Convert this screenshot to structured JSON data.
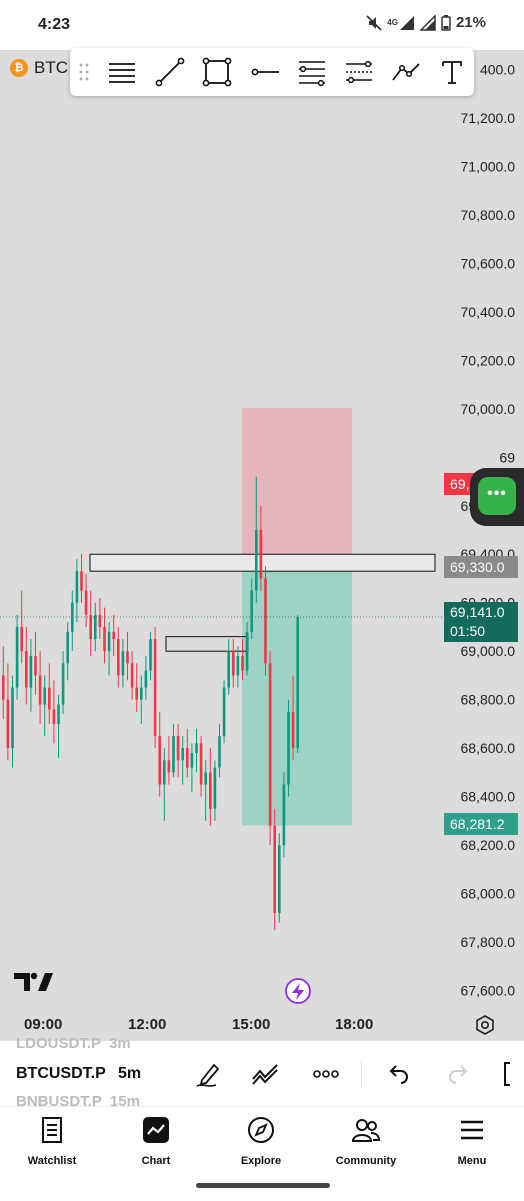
{
  "status_bar": {
    "time": "4:23",
    "network": "4G",
    "battery": "21%"
  },
  "symbol_overlay": {
    "text": "BTC",
    "coin_icon": "bitcoin-icon"
  },
  "drawing_toolbar": {
    "tools": [
      "horizontal-lines-icon",
      "trend-line-icon",
      "rectangle-icon",
      "horizontal-ray-icon",
      "fib-retracement-icon",
      "parallel-channel-icon",
      "path-icon",
      "text-icon"
    ]
  },
  "price_axis": {
    "labels": [
      "400.0",
      "71,200.0",
      "71,000.0",
      "70,800.0",
      "70,600.0",
      "70,400.0",
      "70,200.0",
      "70,000.0",
      "69",
      "69,600.0",
      "69,400.0",
      "69,200.0",
      "69,000.0",
      "68,800.0",
      "68,600.0",
      "68,400.0",
      "68,200.0",
      "68,000.0",
      "67,800.0",
      "67,600.0"
    ],
    "tags": {
      "stop": {
        "value": "69,673.3",
        "color": "#f23645"
      },
      "entry": {
        "value": "69,330.0",
        "color": "#8a8a8a"
      },
      "current": {
        "value": "69,141.0",
        "countdown": "01:50",
        "color": "#136b5c"
      },
      "target": {
        "value": "68,281.2",
        "color": "#2f9e8a"
      }
    }
  },
  "time_axis": {
    "labels": [
      "09:00",
      "12:00",
      "15:00",
      "18:00"
    ]
  },
  "fab": {
    "label": "•••",
    "color": "#35b34a"
  },
  "symbol_bar": {
    "ghost_above": "LDOUSDT.P  3m",
    "symbol": "BTCUSDT.P",
    "interval": "5m",
    "ghost_below": "BNBUSDT.P  15m"
  },
  "bottom_nav": {
    "items": [
      {
        "label": "Watchlist",
        "icon": "watchlist-icon"
      },
      {
        "label": "Chart",
        "icon": "chart-icon"
      },
      {
        "label": "Explore",
        "icon": "compass-icon"
      },
      {
        "label": "Community",
        "icon": "community-icon"
      },
      {
        "label": "Menu",
        "icon": "hamburger-icon"
      }
    ]
  },
  "colors": {
    "up": "#0a9981",
    "down": "#f23645",
    "chart_bg": "#dcdcdc",
    "stop_zone": "#e8a9b1",
    "target_zone": "#8fcfbf"
  },
  "chart_data": {
    "type": "candlestick",
    "timeframe": "5m",
    "x_ticks": [
      "09:00",
      "12:00",
      "15:00",
      "18:00"
    ],
    "ylim": [
      67520,
      71480
    ],
    "position": {
      "type": "short",
      "entry": 69330.0,
      "stop": 69673.3,
      "target": 68281.2,
      "last_price": 69141.0
    },
    "candles": [
      {
        "o": 68900,
        "h": 69020,
        "l": 68720,
        "c": 68800
      },
      {
        "o": 68800,
        "h": 68950,
        "l": 68550,
        "c": 68600
      },
      {
        "o": 68600,
        "h": 68900,
        "l": 68520,
        "c": 68850
      },
      {
        "o": 68850,
        "h": 69150,
        "l": 68800,
        "c": 69100
      },
      {
        "o": 69100,
        "h": 69250,
        "l": 68950,
        "c": 69000
      },
      {
        "o": 69000,
        "h": 69100,
        "l": 68780,
        "c": 68850
      },
      {
        "o": 68850,
        "h": 69050,
        "l": 68750,
        "c": 68980
      },
      {
        "o": 68980,
        "h": 69080,
        "l": 68820,
        "c": 68900
      },
      {
        "o": 68900,
        "h": 69000,
        "l": 68700,
        "c": 68780
      },
      {
        "o": 68780,
        "h": 68900,
        "l": 68650,
        "c": 68850
      },
      {
        "o": 68850,
        "h": 68950,
        "l": 68700,
        "c": 68760
      },
      {
        "o": 68760,
        "h": 68880,
        "l": 68620,
        "c": 68700
      },
      {
        "o": 68700,
        "h": 68820,
        "l": 68560,
        "c": 68780
      },
      {
        "o": 68780,
        "h": 69000,
        "l": 68740,
        "c": 68950
      },
      {
        "o": 68950,
        "h": 69120,
        "l": 68880,
        "c": 69080
      },
      {
        "o": 69080,
        "h": 69250,
        "l": 69000,
        "c": 69200
      },
      {
        "o": 69200,
        "h": 69380,
        "l": 69120,
        "c": 69330
      },
      {
        "o": 69330,
        "h": 69400,
        "l": 69200,
        "c": 69250
      },
      {
        "o": 69250,
        "h": 69320,
        "l": 69100,
        "c": 69150
      },
      {
        "o": 69150,
        "h": 69250,
        "l": 68980,
        "c": 69050
      },
      {
        "o": 69050,
        "h": 69200,
        "l": 69000,
        "c": 69150
      },
      {
        "o": 69150,
        "h": 69220,
        "l": 69050,
        "c": 69100
      },
      {
        "o": 69100,
        "h": 69180,
        "l": 68950,
        "c": 69000
      },
      {
        "o": 69000,
        "h": 69120,
        "l": 68900,
        "c": 69080
      },
      {
        "o": 69080,
        "h": 69150,
        "l": 68980,
        "c": 69050
      },
      {
        "o": 69050,
        "h": 69100,
        "l": 68850,
        "c": 68900
      },
      {
        "o": 68900,
        "h": 69050,
        "l": 68850,
        "c": 69000
      },
      {
        "o": 69000,
        "h": 69080,
        "l": 68880,
        "c": 68950
      },
      {
        "o": 68950,
        "h": 69000,
        "l": 68800,
        "c": 68850
      },
      {
        "o": 68850,
        "h": 68950,
        "l": 68750,
        "c": 68800
      },
      {
        "o": 68800,
        "h": 68900,
        "l": 68700,
        "c": 68850
      },
      {
        "o": 68850,
        "h": 68980,
        "l": 68800,
        "c": 68920
      },
      {
        "o": 68920,
        "h": 69080,
        "l": 68880,
        "c": 69050
      },
      {
        "o": 69050,
        "h": 69100,
        "l": 68600,
        "c": 68650
      },
      {
        "o": 68650,
        "h": 68750,
        "l": 68400,
        "c": 68450
      },
      {
        "o": 68450,
        "h": 68600,
        "l": 68300,
        "c": 68550
      },
      {
        "o": 68550,
        "h": 68650,
        "l": 68450,
        "c": 68500
      },
      {
        "o": 68500,
        "h": 68700,
        "l": 68480,
        "c": 68650
      },
      {
        "o": 68650,
        "h": 68700,
        "l": 68480,
        "c": 68550
      },
      {
        "o": 68550,
        "h": 68650,
        "l": 68450,
        "c": 68600
      },
      {
        "o": 68600,
        "h": 68680,
        "l": 68480,
        "c": 68520
      },
      {
        "o": 68520,
        "h": 68620,
        "l": 68420,
        "c": 68580
      },
      {
        "o": 68580,
        "h": 68680,
        "l": 68500,
        "c": 68620
      },
      {
        "o": 68620,
        "h": 68650,
        "l": 68400,
        "c": 68450
      },
      {
        "o": 68450,
        "h": 68550,
        "l": 68300,
        "c": 68500
      },
      {
        "o": 68500,
        "h": 68600,
        "l": 68280,
        "c": 68350
      },
      {
        "o": 68350,
        "h": 68550,
        "l": 68300,
        "c": 68520
      },
      {
        "o": 68520,
        "h": 68700,
        "l": 68480,
        "c": 68650
      },
      {
        "o": 68650,
        "h": 68880,
        "l": 68620,
        "c": 68850
      },
      {
        "o": 68850,
        "h": 69050,
        "l": 68820,
        "c": 69000
      },
      {
        "o": 69000,
        "h": 69050,
        "l": 68850,
        "c": 68900
      },
      {
        "o": 68900,
        "h": 69020,
        "l": 68850,
        "c": 68980
      },
      {
        "o": 68980,
        "h": 69050,
        "l": 68880,
        "c": 68920
      },
      {
        "o": 68920,
        "h": 69120,
        "l": 68900,
        "c": 69080
      },
      {
        "o": 69080,
        "h": 69300,
        "l": 69050,
        "c": 69250
      },
      {
        "o": 69250,
        "h": 69720,
        "l": 69200,
        "c": 69500
      },
      {
        "o": 69500,
        "h": 69600,
        "l": 69250,
        "c": 69300
      },
      {
        "o": 69300,
        "h": 69350,
        "l": 68900,
        "c": 68950
      },
      {
        "o": 68950,
        "h": 69000,
        "l": 68200,
        "c": 68280
      },
      {
        "o": 68280,
        "h": 68350,
        "l": 67850,
        "c": 67920
      },
      {
        "o": 67920,
        "h": 68250,
        "l": 67880,
        "c": 68200
      },
      {
        "o": 68200,
        "h": 68500,
        "l": 68150,
        "c": 68450
      },
      {
        "o": 68450,
        "h": 68800,
        "l": 68400,
        "c": 68750
      },
      {
        "o": 68750,
        "h": 68900,
        "l": 68550,
        "c": 68600
      },
      {
        "o": 68600,
        "h": 69150,
        "l": 68580,
        "c": 69141
      }
    ]
  }
}
